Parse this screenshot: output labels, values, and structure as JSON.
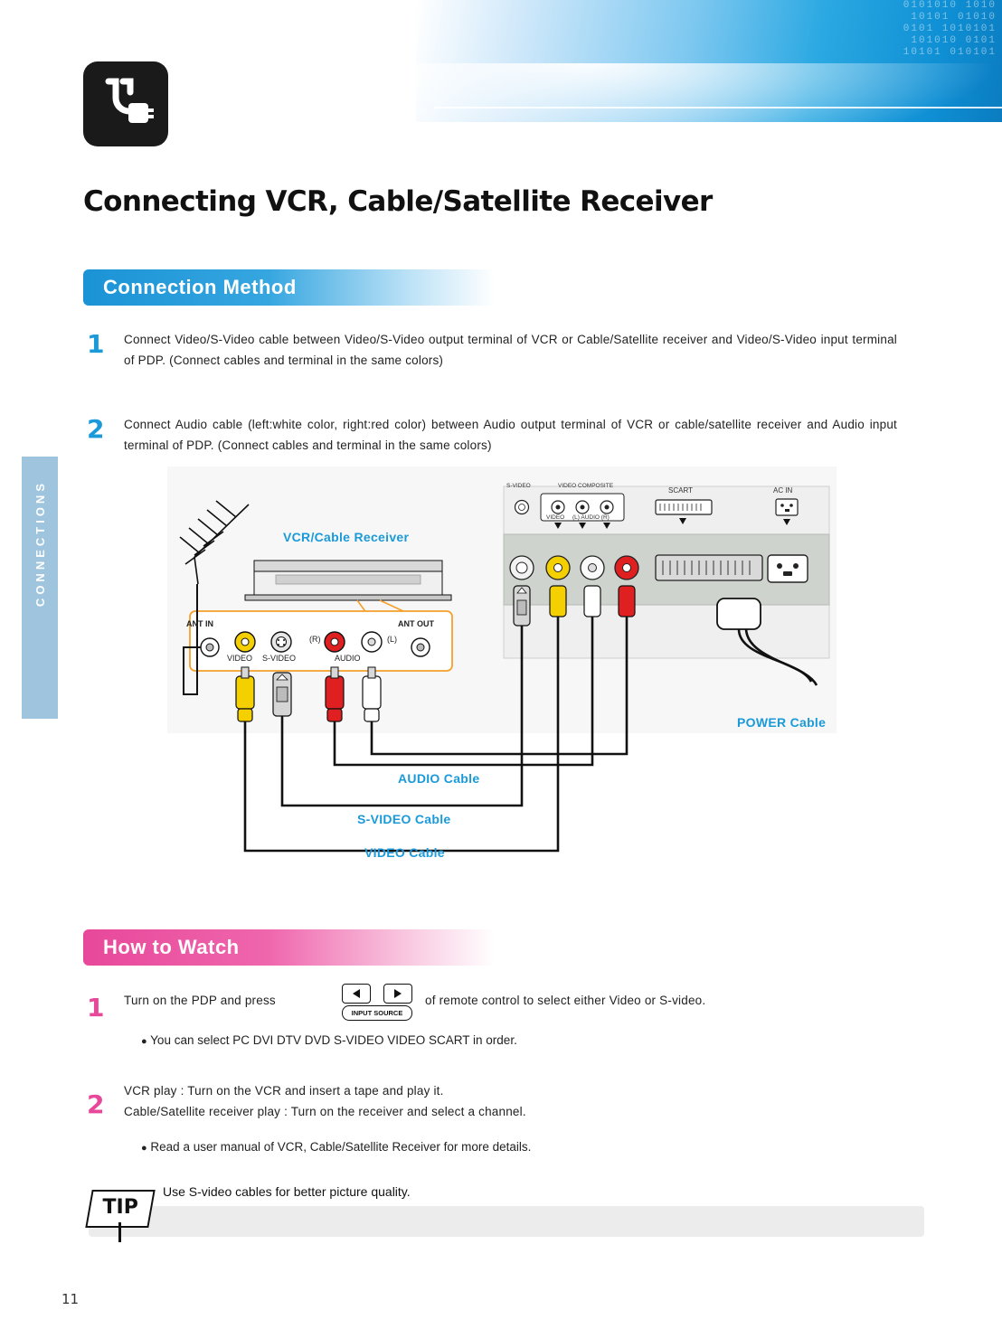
{
  "page": {
    "title": "Connecting VCR, Cable/Satellite Receiver",
    "number": "11",
    "side_tab": "CONNECTIONS"
  },
  "sections": {
    "connection_method": {
      "heading": "Connection  Method",
      "steps": [
        {
          "num": "1",
          "text": "Connect Video/S-Video cable between Video/S-Video output terminal of VCR or Cable/Satellite receiver and Video/S-Video input terminal of PDP. (Connect cables and terminal in the same colors)"
        },
        {
          "num": "2",
          "text": "Connect Audio cable (left:white color, right:red color) between Audio output terminal of VCR or cable/satellite receiver and Audio input terminal of PDP. (Connect cables and terminal in the same colors)"
        }
      ]
    },
    "how_to_watch": {
      "heading": "How  to  Watch",
      "steps": [
        {
          "num": "1",
          "text_before": "Turn on the PDP and press",
          "text_after": "of remote control to select either Video or S-video.",
          "bullet": "You can select    PC    DVI    DTV    DVD    S-VIDEO    VIDEO    SCART    in order."
        },
        {
          "num": "2",
          "line1": "VCR play : Turn on the VCR and insert a tape and play it.",
          "line2": "Cable/Satellite receiver play : Turn on the receiver and select a channel.",
          "bullet": "Read a user manual of VCR, Cable/Satellite Receiver for more details."
        }
      ]
    }
  },
  "remote": {
    "left_button_icon": "left-triangle-icon",
    "right_button_icon": "right-triangle-icon",
    "input_source_label": "INPUT SOURCE"
  },
  "tip": {
    "badge": "TIP",
    "text": "Use S-video cables for better picture quality."
  },
  "diagram": {
    "device_label": "VCR/Cable  Receiver",
    "power_cable_label": "POWER  Cable",
    "audio_cable_label": "AUDIO  Cable",
    "svideo_cable_label": "S-VIDEO  Cable",
    "video_cable_label": "VIDEO  Cable",
    "vcr_ports": {
      "ant_in": "ANT IN",
      "ant_out": "ANT OUT",
      "video": "VIDEO",
      "svideo": "S-VIDEO",
      "audio": "AUDIO",
      "right": "(R)",
      "left": "(L)"
    },
    "pdp_panel": {
      "svideo": "S-VIDEO",
      "video_composite": "VIDEO COMPOSITE",
      "video": "VIDEO",
      "audio": "(L) AUDIO (R)",
      "scart": "SCART",
      "ac_in": "AC IN"
    }
  },
  "colors": {
    "blue": "#1a9ad9",
    "pink": "#e8489a",
    "yellow": "#f5d000",
    "red": "#e02020",
    "white": "#ffffff"
  }
}
